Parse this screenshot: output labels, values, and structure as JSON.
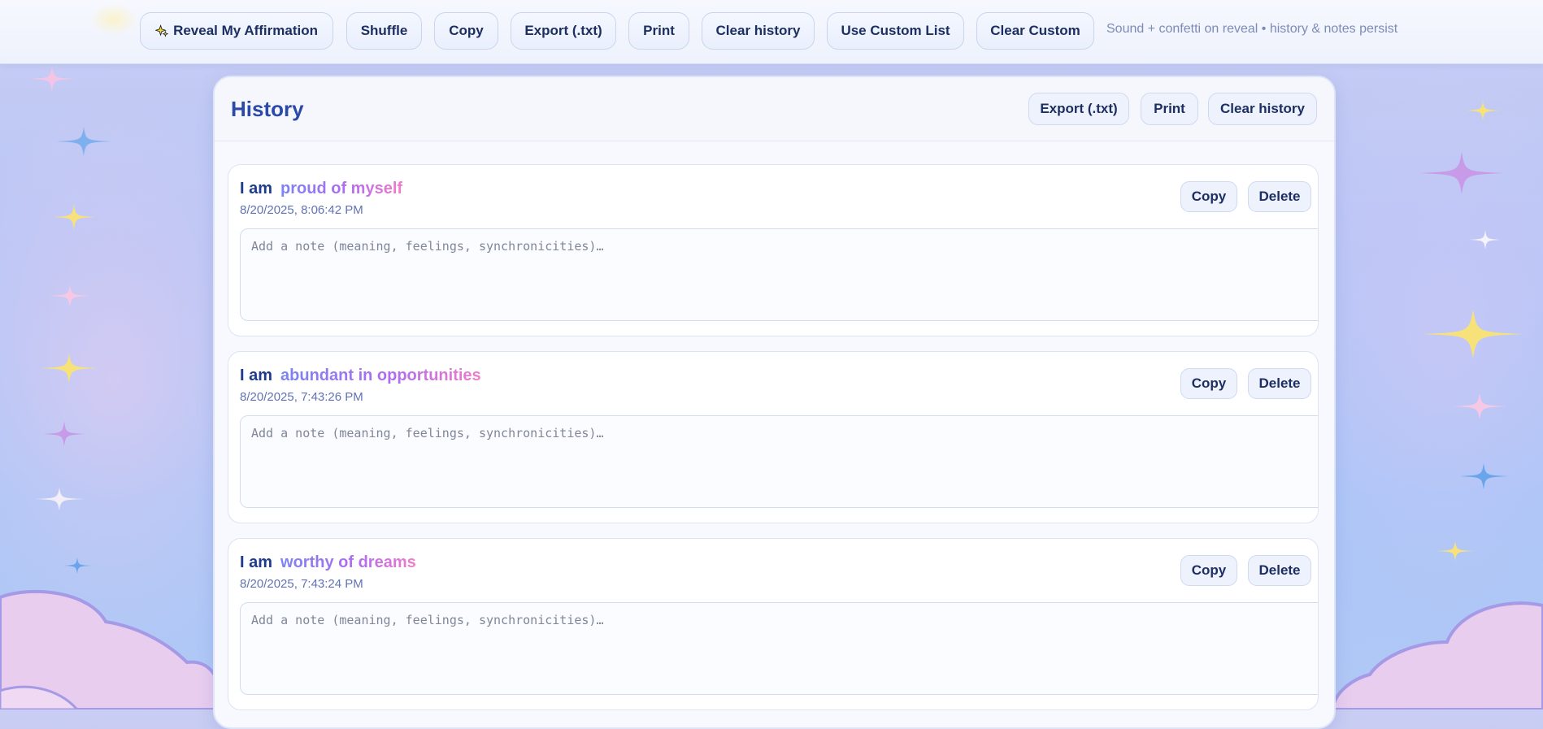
{
  "toolbar": {
    "reveal_label": "Reveal My Affirmation",
    "reveal_icon": "sparkles-icon",
    "shuffle_label": "Shuffle",
    "copy_label": "Copy",
    "export_label": "Export (.txt)",
    "print_label": "Print",
    "clear_history_label": "Clear history",
    "use_custom_label": "Use Custom List",
    "clear_custom_label": "Clear Custom",
    "note": "Sound + confetti on reveal • history & notes persist"
  },
  "history": {
    "title": "History",
    "export_label": "Export (.txt)",
    "print_label": "Print",
    "clear_label": "Clear history",
    "entries": [
      {
        "prefix": "I am",
        "affirmation": "proud of myself",
        "timestamp": "8/20/2025, 8:06:42 PM",
        "copy_label": "Copy",
        "delete_label": "Delete",
        "note_placeholder": "Add a note (meaning, feelings, synchronicities)…",
        "note_value": ""
      },
      {
        "prefix": "I am",
        "affirmation": "abundant in opportunities",
        "timestamp": "8/20/2025, 7:43:26 PM",
        "copy_label": "Copy",
        "delete_label": "Delete",
        "note_placeholder": "Add a note (meaning, feelings, synchronicities)…",
        "note_value": ""
      },
      {
        "prefix": "I am",
        "affirmation": "worthy of dreams",
        "timestamp": "8/20/2025, 7:43:24 PM",
        "copy_label": "Copy",
        "delete_label": "Delete",
        "note_placeholder": "Add a note (meaning, feelings, synchronicities)…",
        "note_value": ""
      }
    ]
  },
  "colors": {
    "title": "#2b4aa8",
    "button_text": "#1d2f62",
    "affirmation_gradient": [
      "#7a84f2",
      "#b06cf0",
      "#f27cc9"
    ],
    "timestamp": "#6173b5"
  }
}
